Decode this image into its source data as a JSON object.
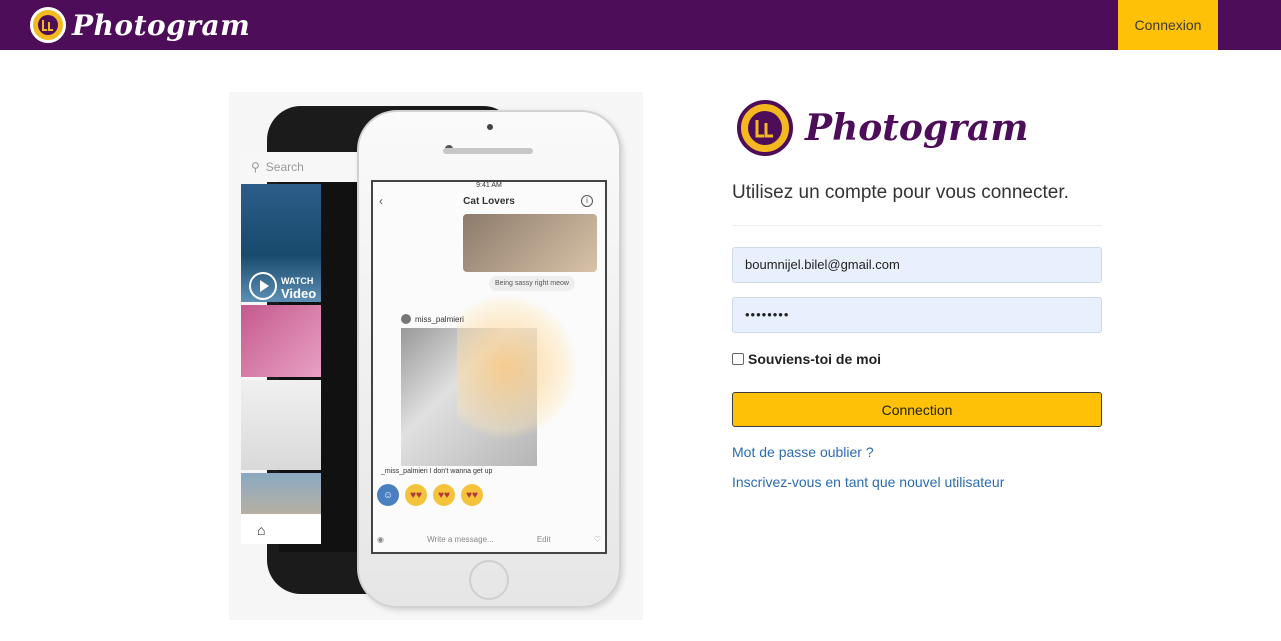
{
  "navbar": {
    "brand": "Photogram",
    "login_label": "Connexion"
  },
  "phones": {
    "back_search_placeholder": "Search",
    "back_watch": "WATCH",
    "back_video": "Video",
    "front_status_time": "9:41 AM",
    "front_chat_title": "Cat Lovers",
    "front_message": "Being sassy right meow",
    "front_post_user": "miss_palmieri",
    "front_caption": "_miss_palmieri I don't wanna get up",
    "front_message_placeholder": "Write a message...",
    "front_edit": "Edit"
  },
  "login": {
    "brand": "Photogram",
    "subtitle": "Utilisez un compte pour vous connecter.",
    "email_value": "boumnijel.bilel@gmail.com",
    "password_value": "••••••••",
    "remember_label": "Souviens-toi de moi",
    "submit_label": "Connection",
    "forgot_link": "Mot de passe oublier ?",
    "register_link": "Inscrivez-vous en tant que nouvel utilisateur"
  },
  "colors": {
    "navbar_bg": "#4e0d59",
    "accent_yellow": "#ffc107",
    "link_blue": "#2b6cb0",
    "input_bg": "#e8f0fe"
  }
}
